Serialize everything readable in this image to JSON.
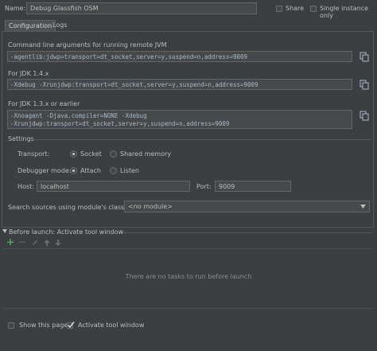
{
  "header": {
    "name_label": "Name:",
    "name_value": "Debug Glassfish OSM",
    "share_label": "Share",
    "single_instance_label": "Single instance only"
  },
  "tabs": [
    {
      "label": "Configuration",
      "active": true
    },
    {
      "label": "Logs",
      "active": false
    }
  ],
  "args": {
    "cmd_label": "Command line arguments for running remote JVM",
    "cmd_value": "-agentlib:jdwp=transport=dt_socket,server=y,suspend=n,address=9009",
    "jdk14_label": "For JDK 1.4.x",
    "jdk14_value": "-Xdebug -Xrunjdwp:transport=dt_socket,server=y,suspend=n,address=9009",
    "jdk13_label": "For JDK 1.3.x or earlier",
    "jdk13_line1": "-Xnoagent -Djava.compiler=NONE -Xdebug",
    "jdk13_line2": "-Xrunjdwp:transport=dt_socket,server=y,suspend=n,address=9009"
  },
  "settings": {
    "title": "Settings",
    "transport_label": "Transport:",
    "transport_options": [
      "Socket",
      "Shared memory"
    ],
    "transport_selected": "Socket",
    "mode_label": "Debugger mode:",
    "mode_options": [
      "Attach",
      "Listen"
    ],
    "mode_selected": "Attach",
    "host_label": "Host:",
    "host_value": "localhost",
    "port_label": "Port:",
    "port_value": "9009",
    "sources_label": "Search sources using module's classpath:",
    "sources_value": "<no module>"
  },
  "before_launch": {
    "title": "Before launch: Activate tool window",
    "empty_text": "There are no tasks to run before launch"
  },
  "footer": {
    "show_page_label": "Show this page",
    "activate_label": "Activate tool window"
  },
  "colors": {
    "background": "#3c3f41",
    "field": "#45494a",
    "add_green": "#59a869"
  }
}
